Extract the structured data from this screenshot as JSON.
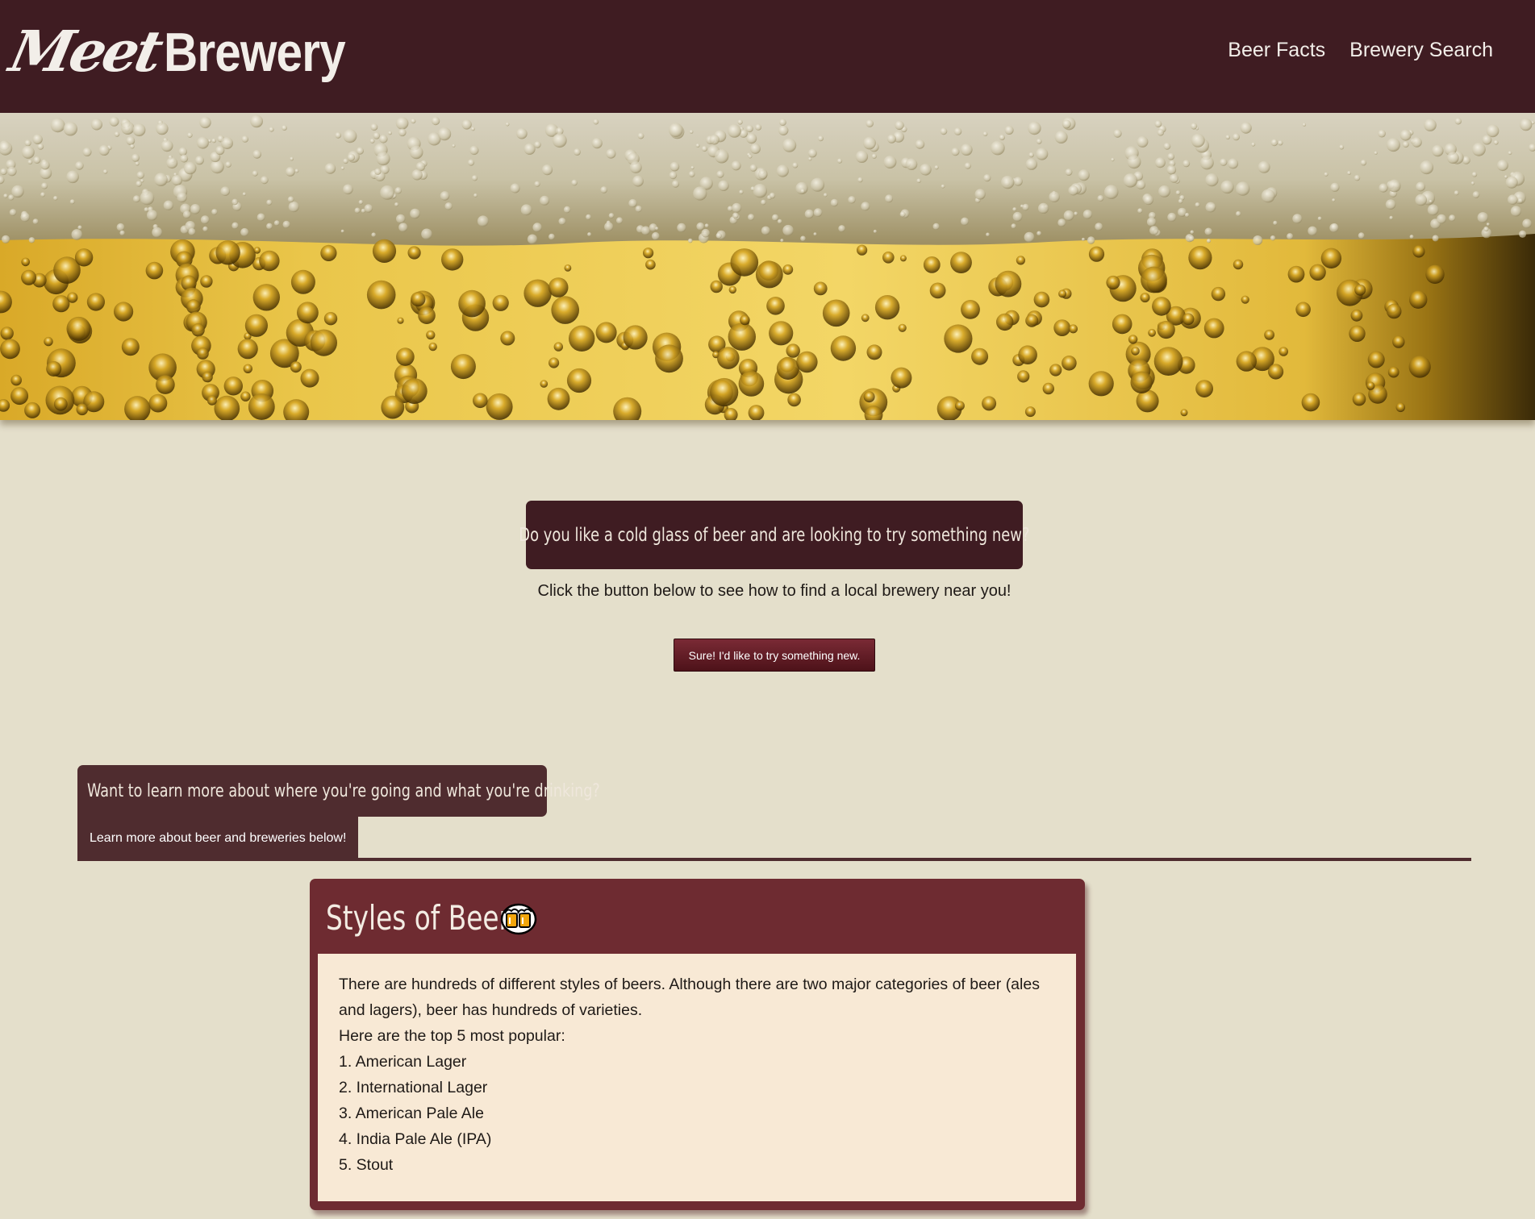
{
  "header": {
    "logo_script": "Meet",
    "logo_bold": "Brewery",
    "nav": [
      "Beer Facts",
      "Brewery Search"
    ]
  },
  "intro": {
    "title": "Do you like a cold glass of beer and are looking to try something new?",
    "subtitle": "Click the button below to see how to find a local brewery near you!",
    "button_label": "Sure! I'd like to try something new."
  },
  "learn": {
    "title": "Want to learn more about where you're going and what you're drinking?",
    "subtitle": "Learn more about beer and breweries below!"
  },
  "card": {
    "title": "Styles of Beer",
    "paragraph": "There are hundreds of different styles of beers. Although there are two major categories of beer (ales and lagers), beer has hundreds of varieties.",
    "list_intro": "Here are the top 5 most popular:",
    "items": [
      "1. American Lager",
      "2. International Lager",
      "3. American Pale Ale",
      "4. India Pale Ale (IPA)",
      "5. Stout"
    ]
  },
  "colors": {
    "header_bg": "#3f1c22",
    "page_bg": "#e4dfcb",
    "card_bg": "#6e2b31",
    "card_body_bg": "#f8e9d5",
    "beer_gold": "#e2b93b"
  },
  "icons": {
    "beer": "clinking-beer-mugs-icon"
  }
}
